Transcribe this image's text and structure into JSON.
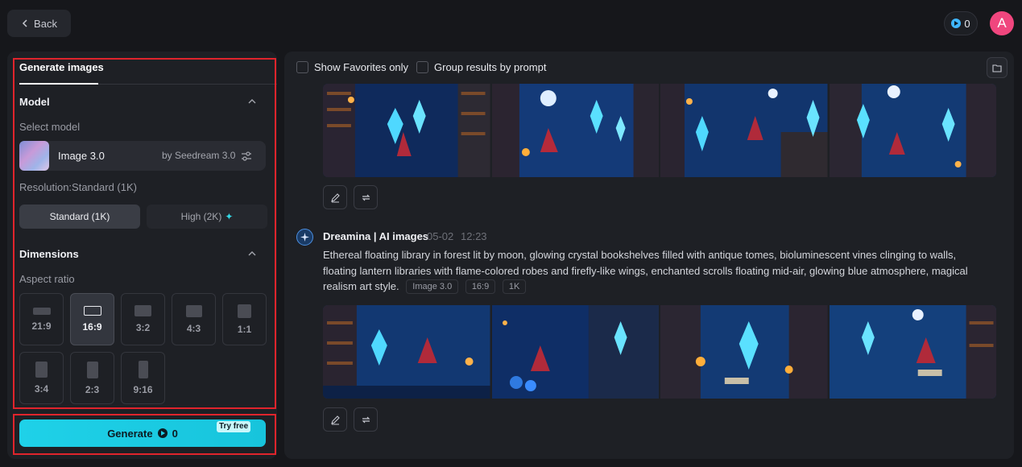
{
  "header": {
    "back_label": "Back",
    "credits": "0",
    "avatar_initial": "A"
  },
  "left": {
    "tab_label": "Generate images",
    "model_section": "Model",
    "select_model_label": "Select model",
    "model_name": "Image 3.0",
    "model_by": "by Seedream 3.0",
    "resolution_label": "Resolution:Standard (1K)",
    "res_standard": "Standard (1K)",
    "res_high": "High (2K)",
    "dimensions_section": "Dimensions",
    "aspect_ratio_label": "Aspect ratio",
    "ratios": [
      {
        "label": "21:9",
        "selected": false
      },
      {
        "label": "16:9",
        "selected": true
      },
      {
        "label": "3:2",
        "selected": false
      },
      {
        "label": "4:3",
        "selected": false
      },
      {
        "label": "1:1",
        "selected": false
      },
      {
        "label": "3:4",
        "selected": false
      },
      {
        "label": "2:3",
        "selected": false
      },
      {
        "label": "9:16",
        "selected": false
      }
    ],
    "generate_label": "Generate",
    "generate_cost": "0",
    "try_free": "Try free"
  },
  "right": {
    "show_favorites": "Show Favorites only",
    "group_by_prompt": "Group results by prompt",
    "author": "Dreamina | AI images",
    "date": "05-02",
    "time": "12:23",
    "prompt": "Ethereal floating library in forest lit by moon, glowing crystal bookshelves filled with antique tomes, bioluminescent vines clinging to walls, floating lantern libraries with flame-colored robes and firefly-like wings, enchanted scrolls floating mid-air, glowing blue atmosphere, magical realism art style.",
    "tags": [
      "Image 3.0",
      "16:9",
      "1K"
    ]
  },
  "colors": {
    "accent": "#1fd1e8",
    "highlight_outline": "#e0242c",
    "avatar": "#f0467e"
  }
}
